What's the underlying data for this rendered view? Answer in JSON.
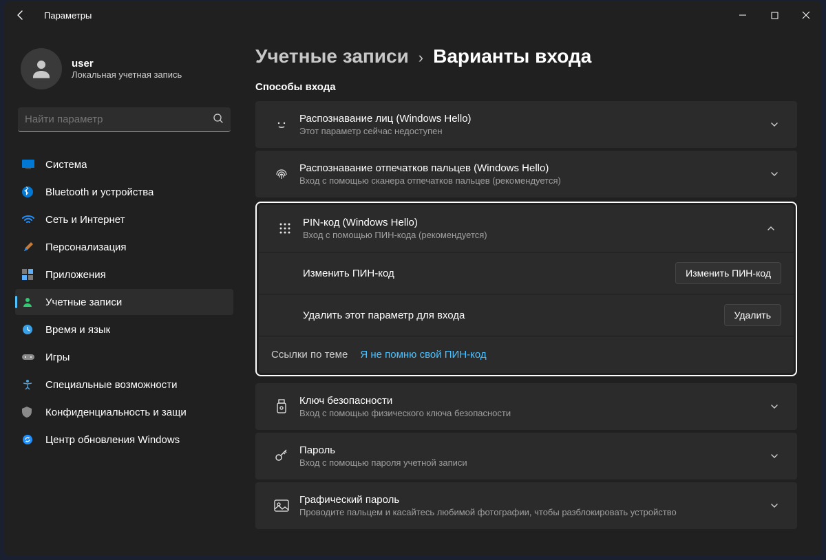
{
  "titlebar": {
    "app_title": "Параметры"
  },
  "user": {
    "name": "user",
    "desc": "Локальная учетная запись"
  },
  "search": {
    "placeholder": "Найти параметр"
  },
  "sidebar": {
    "items": [
      {
        "label": "Система"
      },
      {
        "label": "Bluetooth и устройства"
      },
      {
        "label": "Сеть и Интернет"
      },
      {
        "label": "Персонализация"
      },
      {
        "label": "Приложения"
      },
      {
        "label": "Учетные записи"
      },
      {
        "label": "Время и язык"
      },
      {
        "label": "Игры"
      },
      {
        "label": "Специальные возможности"
      },
      {
        "label": "Конфиденциальность и защи"
      },
      {
        "label": "Центр обновления Windows"
      }
    ]
  },
  "breadcrumb": {
    "parent": "Учетные записи",
    "sep": "›",
    "current": "Варианты входа"
  },
  "section": {
    "title": "Способы входа"
  },
  "cards": {
    "face": {
      "title": "Распознавание лиц (Windows Hello)",
      "desc": "Этот параметр сейчас недоступен"
    },
    "finger": {
      "title": "Распознавание отпечатков пальцев (Windows Hello)",
      "desc": "Вход с помощью сканера отпечатков пальцев (рекомендуется)"
    },
    "pin": {
      "title": "PIN-код (Windows Hello)",
      "desc": "Вход с помощью ПИН-кода (рекомендуется)"
    },
    "seckey": {
      "title": "Ключ безопасности",
      "desc": "Вход с помощью физического ключа безопасности"
    },
    "pwd": {
      "title": "Пароль",
      "desc": "Вход с помощью пароля учетной записи"
    },
    "pic": {
      "title": "Графический пароль",
      "desc": "Проводите пальцем и касайтесь любимой фотографии, чтобы разблокировать устройство"
    }
  },
  "pin": {
    "change_label": "Изменить ПИН-код",
    "change_btn": "Изменить ПИН-код",
    "remove_label": "Удалить этот параметр для входа",
    "remove_btn": "Удалить",
    "links_label": "Ссылки по теме",
    "forgot_link": "Я не помню свой ПИН-код"
  }
}
